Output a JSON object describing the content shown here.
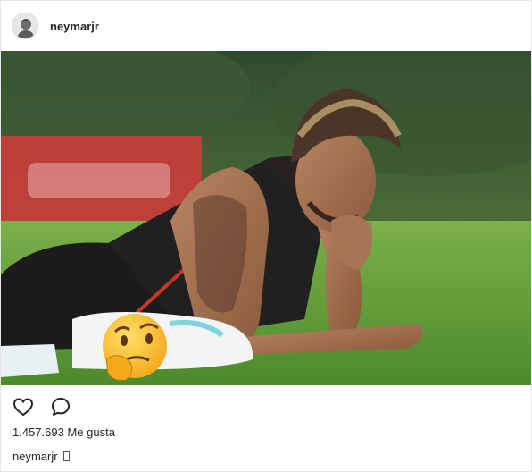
{
  "post": {
    "username": "neymarjr",
    "likes_count": "1.457.693",
    "likes_label": "Me gusta",
    "caption_user": "neymarjr",
    "caption_text": ""
  },
  "icons": {
    "avatar": "avatar-icon",
    "like": "heart-outline-icon",
    "comment": "comment-bubble-icon",
    "caption_glyph": "missing-glyph-box"
  },
  "colors": {
    "text": "#262626",
    "border": "#e6e6e6",
    "grass": "#5e9a3a",
    "banner_red": "#d23a3a"
  }
}
